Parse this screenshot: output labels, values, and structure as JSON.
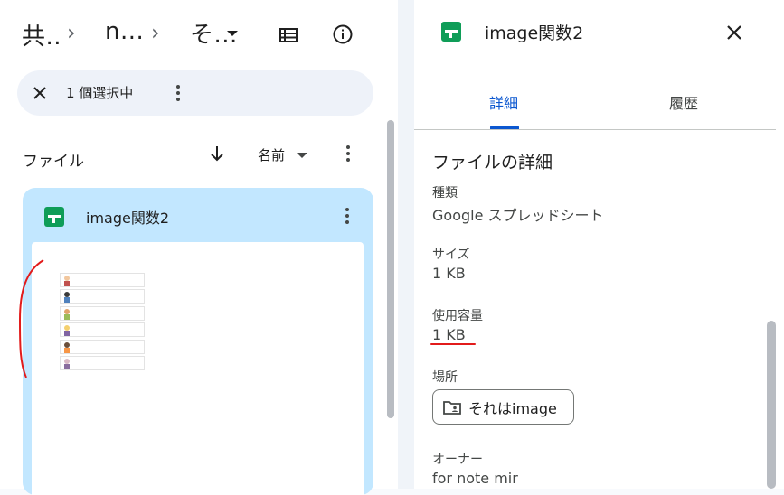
{
  "breadcrumb": {
    "items": [
      "共..",
      "n...",
      "そ..."
    ]
  },
  "selection": {
    "text": "1 個選択中"
  },
  "files": {
    "section_label": "ファイル",
    "sort_label": "名前",
    "card_title": "image関数2"
  },
  "details_panel": {
    "title": "image関数2",
    "tabs": [
      "詳細",
      "履歴"
    ],
    "active_tab": "詳細",
    "heading": "ファイルの詳細",
    "type_label": "種類",
    "type_value": "Google スプレッドシート",
    "size_label": "サイズ",
    "size_value": "1 KB",
    "storage_label": "使用容量",
    "storage_value": "1 KB",
    "location_label": "場所",
    "location_value": "それはimage",
    "owner_label": "オーナー",
    "owner_value": "for note mir"
  },
  "icons": {
    "spreadsheet": "google-sheets-icon",
    "close": "close-icon",
    "more": "more-vert-icon",
    "info": "info-icon",
    "list": "list-view-icon",
    "sort": "arrow-down-icon",
    "folder": "shared-folder-icon"
  },
  "colors": {
    "accent": "#0b57d0",
    "card_selected": "#c2e7ff",
    "sheets_green": "#0f9d58",
    "annotation_red": "#e21b1b"
  }
}
